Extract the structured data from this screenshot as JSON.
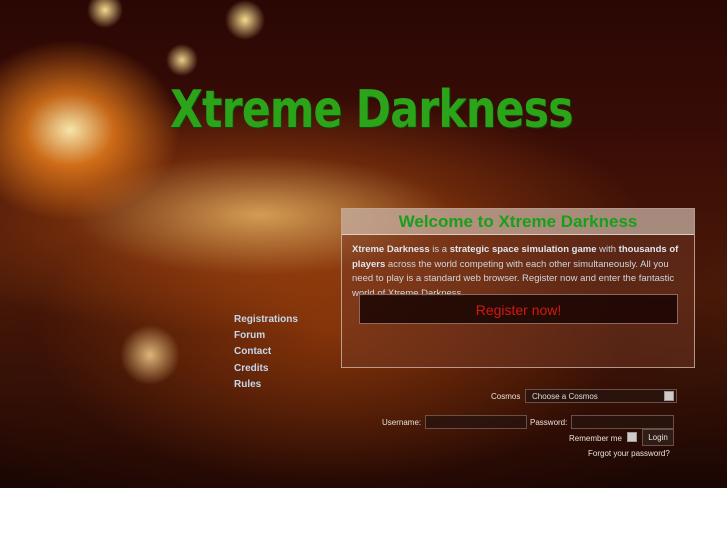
{
  "logo": "Xtreme Darkness",
  "nav": [
    "Registrations",
    "Forum",
    "Contact",
    "Credits",
    "Rules"
  ],
  "welcome": {
    "title": "Welcome to Xtreme Darkness",
    "t1": "Xtreme Darkness",
    "t2": " is a ",
    "t3": "strategic space simulation game",
    "t4": " with ",
    "t5": "thousands of players",
    "t6": " across the world competing with each other simultaneously. All you need to play is a standard web browser. Register now and enter the fantastic world of Xtreme Darkness.",
    "register": "Register now!"
  },
  "login": {
    "cosmos_label": "Cosmos",
    "cosmos_value": "Choose a Cosmos",
    "username_label": "Username:",
    "password_label": "Password:",
    "remember_label": "Remember me",
    "login_button": "Login",
    "forgot": "Forgot your password?"
  }
}
